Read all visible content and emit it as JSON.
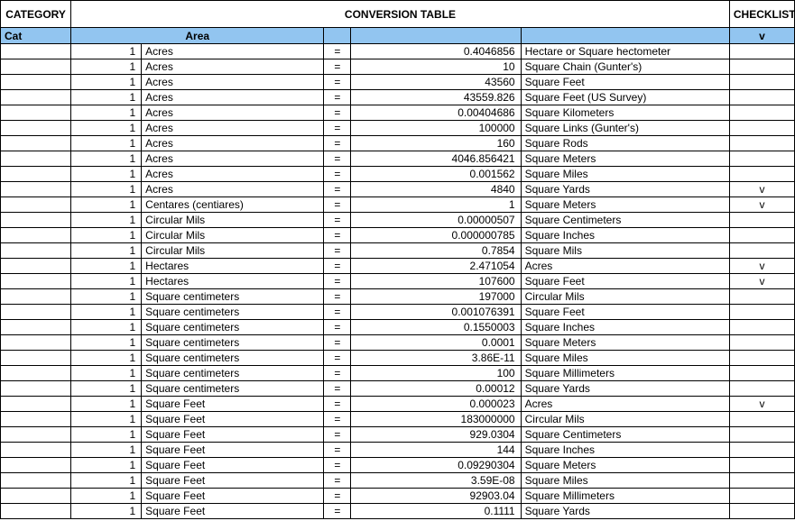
{
  "header": {
    "category": "CATEGORY",
    "title": "CONVERSION TABLE",
    "checklist": "CHECKLIST"
  },
  "blue": {
    "cat": "Cat",
    "area": "Area",
    "v": "v"
  },
  "eq": "=",
  "rows": [
    {
      "qty": "1",
      "from": "Acres",
      "val": "0.4046856",
      "to": "Hectare or Square hectometer",
      "chk": ""
    },
    {
      "qty": "1",
      "from": "Acres",
      "val": "10",
      "to": "Square Chain (Gunter's)",
      "chk": ""
    },
    {
      "qty": "1",
      "from": "Acres",
      "val": "43560",
      "to": "Square Feet",
      "chk": ""
    },
    {
      "qty": "1",
      "from": "Acres",
      "val": "43559.826",
      "to": "Square Feet (US Survey)",
      "chk": ""
    },
    {
      "qty": "1",
      "from": "Acres",
      "val": "0.00404686",
      "to": "Square Kilometers",
      "chk": ""
    },
    {
      "qty": "1",
      "from": "Acres",
      "val": "100000",
      "to": "Square Links (Gunter's)",
      "chk": ""
    },
    {
      "qty": "1",
      "from": "Acres",
      "val": "160",
      "to": "Square Rods",
      "chk": ""
    },
    {
      "qty": "1",
      "from": "Acres",
      "val": "4046.856421",
      "to": "Square Meters",
      "chk": ""
    },
    {
      "qty": "1",
      "from": "Acres",
      "val": "0.001562",
      "to": "Square Miles",
      "chk": ""
    },
    {
      "qty": "1",
      "from": "Acres",
      "val": "4840",
      "to": "Square Yards",
      "chk": "v"
    },
    {
      "qty": "1",
      "from": "Centares (centiares)",
      "val": "1",
      "to": "Square Meters",
      "chk": "v"
    },
    {
      "qty": "1",
      "from": "Circular Mils",
      "val": "0.00000507",
      "to": "Square Centimeters",
      "chk": ""
    },
    {
      "qty": "1",
      "from": "Circular Mils",
      "val": "0.000000785",
      "to": "Square Inches",
      "chk": ""
    },
    {
      "qty": "1",
      "from": "Circular Mils",
      "val": "0.7854",
      "to": "Square Mils",
      "chk": ""
    },
    {
      "qty": "1",
      "from": "Hectares",
      "val": "2.471054",
      "to": "Acres",
      "chk": "v"
    },
    {
      "qty": "1",
      "from": "Hectares",
      "val": "107600",
      "to": "Square Feet",
      "chk": "v"
    },
    {
      "qty": "1",
      "from": "Square centimeters",
      "val": "197000",
      "to": "Circular Mils",
      "chk": ""
    },
    {
      "qty": "1",
      "from": "Square centimeters",
      "val": "0.001076391",
      "to": "Square Feet",
      "chk": ""
    },
    {
      "qty": "1",
      "from": "Square centimeters",
      "val": "0.1550003",
      "to": "Square Inches",
      "chk": ""
    },
    {
      "qty": "1",
      "from": "Square centimeters",
      "val": "0.0001",
      "to": "Square Meters",
      "chk": ""
    },
    {
      "qty": "1",
      "from": "Square centimeters",
      "val": "3.86E-11",
      "to": "Square Miles",
      "chk": ""
    },
    {
      "qty": "1",
      "from": "Square centimeters",
      "val": "100",
      "to": "Square Millimeters",
      "chk": ""
    },
    {
      "qty": "1",
      "from": "Square centimeters",
      "val": "0.00012",
      "to": "Square Yards",
      "chk": ""
    },
    {
      "qty": "1",
      "from": "Square Feet",
      "val": "0.000023",
      "to": "Acres",
      "chk": "v"
    },
    {
      "qty": "1",
      "from": "Square Feet",
      "val": "183000000",
      "to": "Circular Mils",
      "chk": ""
    },
    {
      "qty": "1",
      "from": "Square Feet",
      "val": "929.0304",
      "to": "Square Centimeters",
      "chk": ""
    },
    {
      "qty": "1",
      "from": "Square Feet",
      "val": "144",
      "to": "Square Inches",
      "chk": ""
    },
    {
      "qty": "1",
      "from": "Square Feet",
      "val": "0.09290304",
      "to": "Square Meters",
      "chk": ""
    },
    {
      "qty": "1",
      "from": "Square Feet",
      "val": "3.59E-08",
      "to": "Square Miles",
      "chk": ""
    },
    {
      "qty": "1",
      "from": "Square Feet",
      "val": "92903.04",
      "to": "Square Millimeters",
      "chk": ""
    },
    {
      "qty": "1",
      "from": "Square Feet",
      "val": "0.1111",
      "to": "Square Yards",
      "chk": ""
    }
  ]
}
